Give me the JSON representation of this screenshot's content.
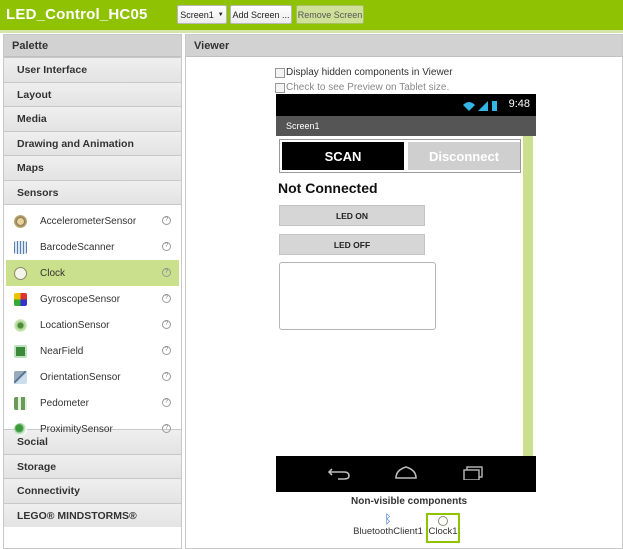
{
  "header": {
    "project_name": "LED_Control_HC05",
    "screen_dropdown": "Screen1",
    "add_screen": "Add Screen ...",
    "remove_screen": "Remove Screen",
    "accent_color": "#8fc202"
  },
  "palette": {
    "title": "Palette",
    "categories_top": [
      "User Interface",
      "Layout",
      "Media",
      "Drawing and Animation",
      "Maps",
      "Sensors"
    ],
    "sensor_items": [
      {
        "label": "AccelerometerSensor",
        "icon": "accelerometer-icon"
      },
      {
        "label": "BarcodeScanner",
        "icon": "barcode-icon"
      },
      {
        "label": "Clock",
        "icon": "clock-icon",
        "selected": true
      },
      {
        "label": "GyroscopeSensor",
        "icon": "gyroscope-icon"
      },
      {
        "label": "LocationSensor",
        "icon": "location-icon"
      },
      {
        "label": "NearField",
        "icon": "nearfield-icon"
      },
      {
        "label": "OrientationSensor",
        "icon": "orientation-icon"
      },
      {
        "label": "Pedometer",
        "icon": "pedometer-icon"
      },
      {
        "label": "ProximitySensor",
        "icon": "proximity-icon"
      }
    ],
    "help_glyph": "?",
    "categories_bottom": [
      "Social",
      "Storage",
      "Connectivity",
      "LEGO® MINDSTORMS®"
    ]
  },
  "viewer": {
    "title": "Viewer",
    "show_hidden_label": "Display hidden components in Viewer",
    "tablet_preview_label": "Check to see Preview on Tablet size.",
    "phone": {
      "time": "9:48",
      "screen_title": "Screen1",
      "scan_button": "SCAN",
      "disconnect_button": "Disconnect",
      "status_label": "Not Connected",
      "led_on_button": "LED ON",
      "led_off_button": "LED OFF"
    },
    "non_visible_title": "Non-visible components",
    "non_visible": [
      {
        "label": "BluetoothClient1",
        "icon": "bluetooth-icon"
      },
      {
        "label": "Clock1",
        "icon": "clock-icon"
      }
    ]
  }
}
